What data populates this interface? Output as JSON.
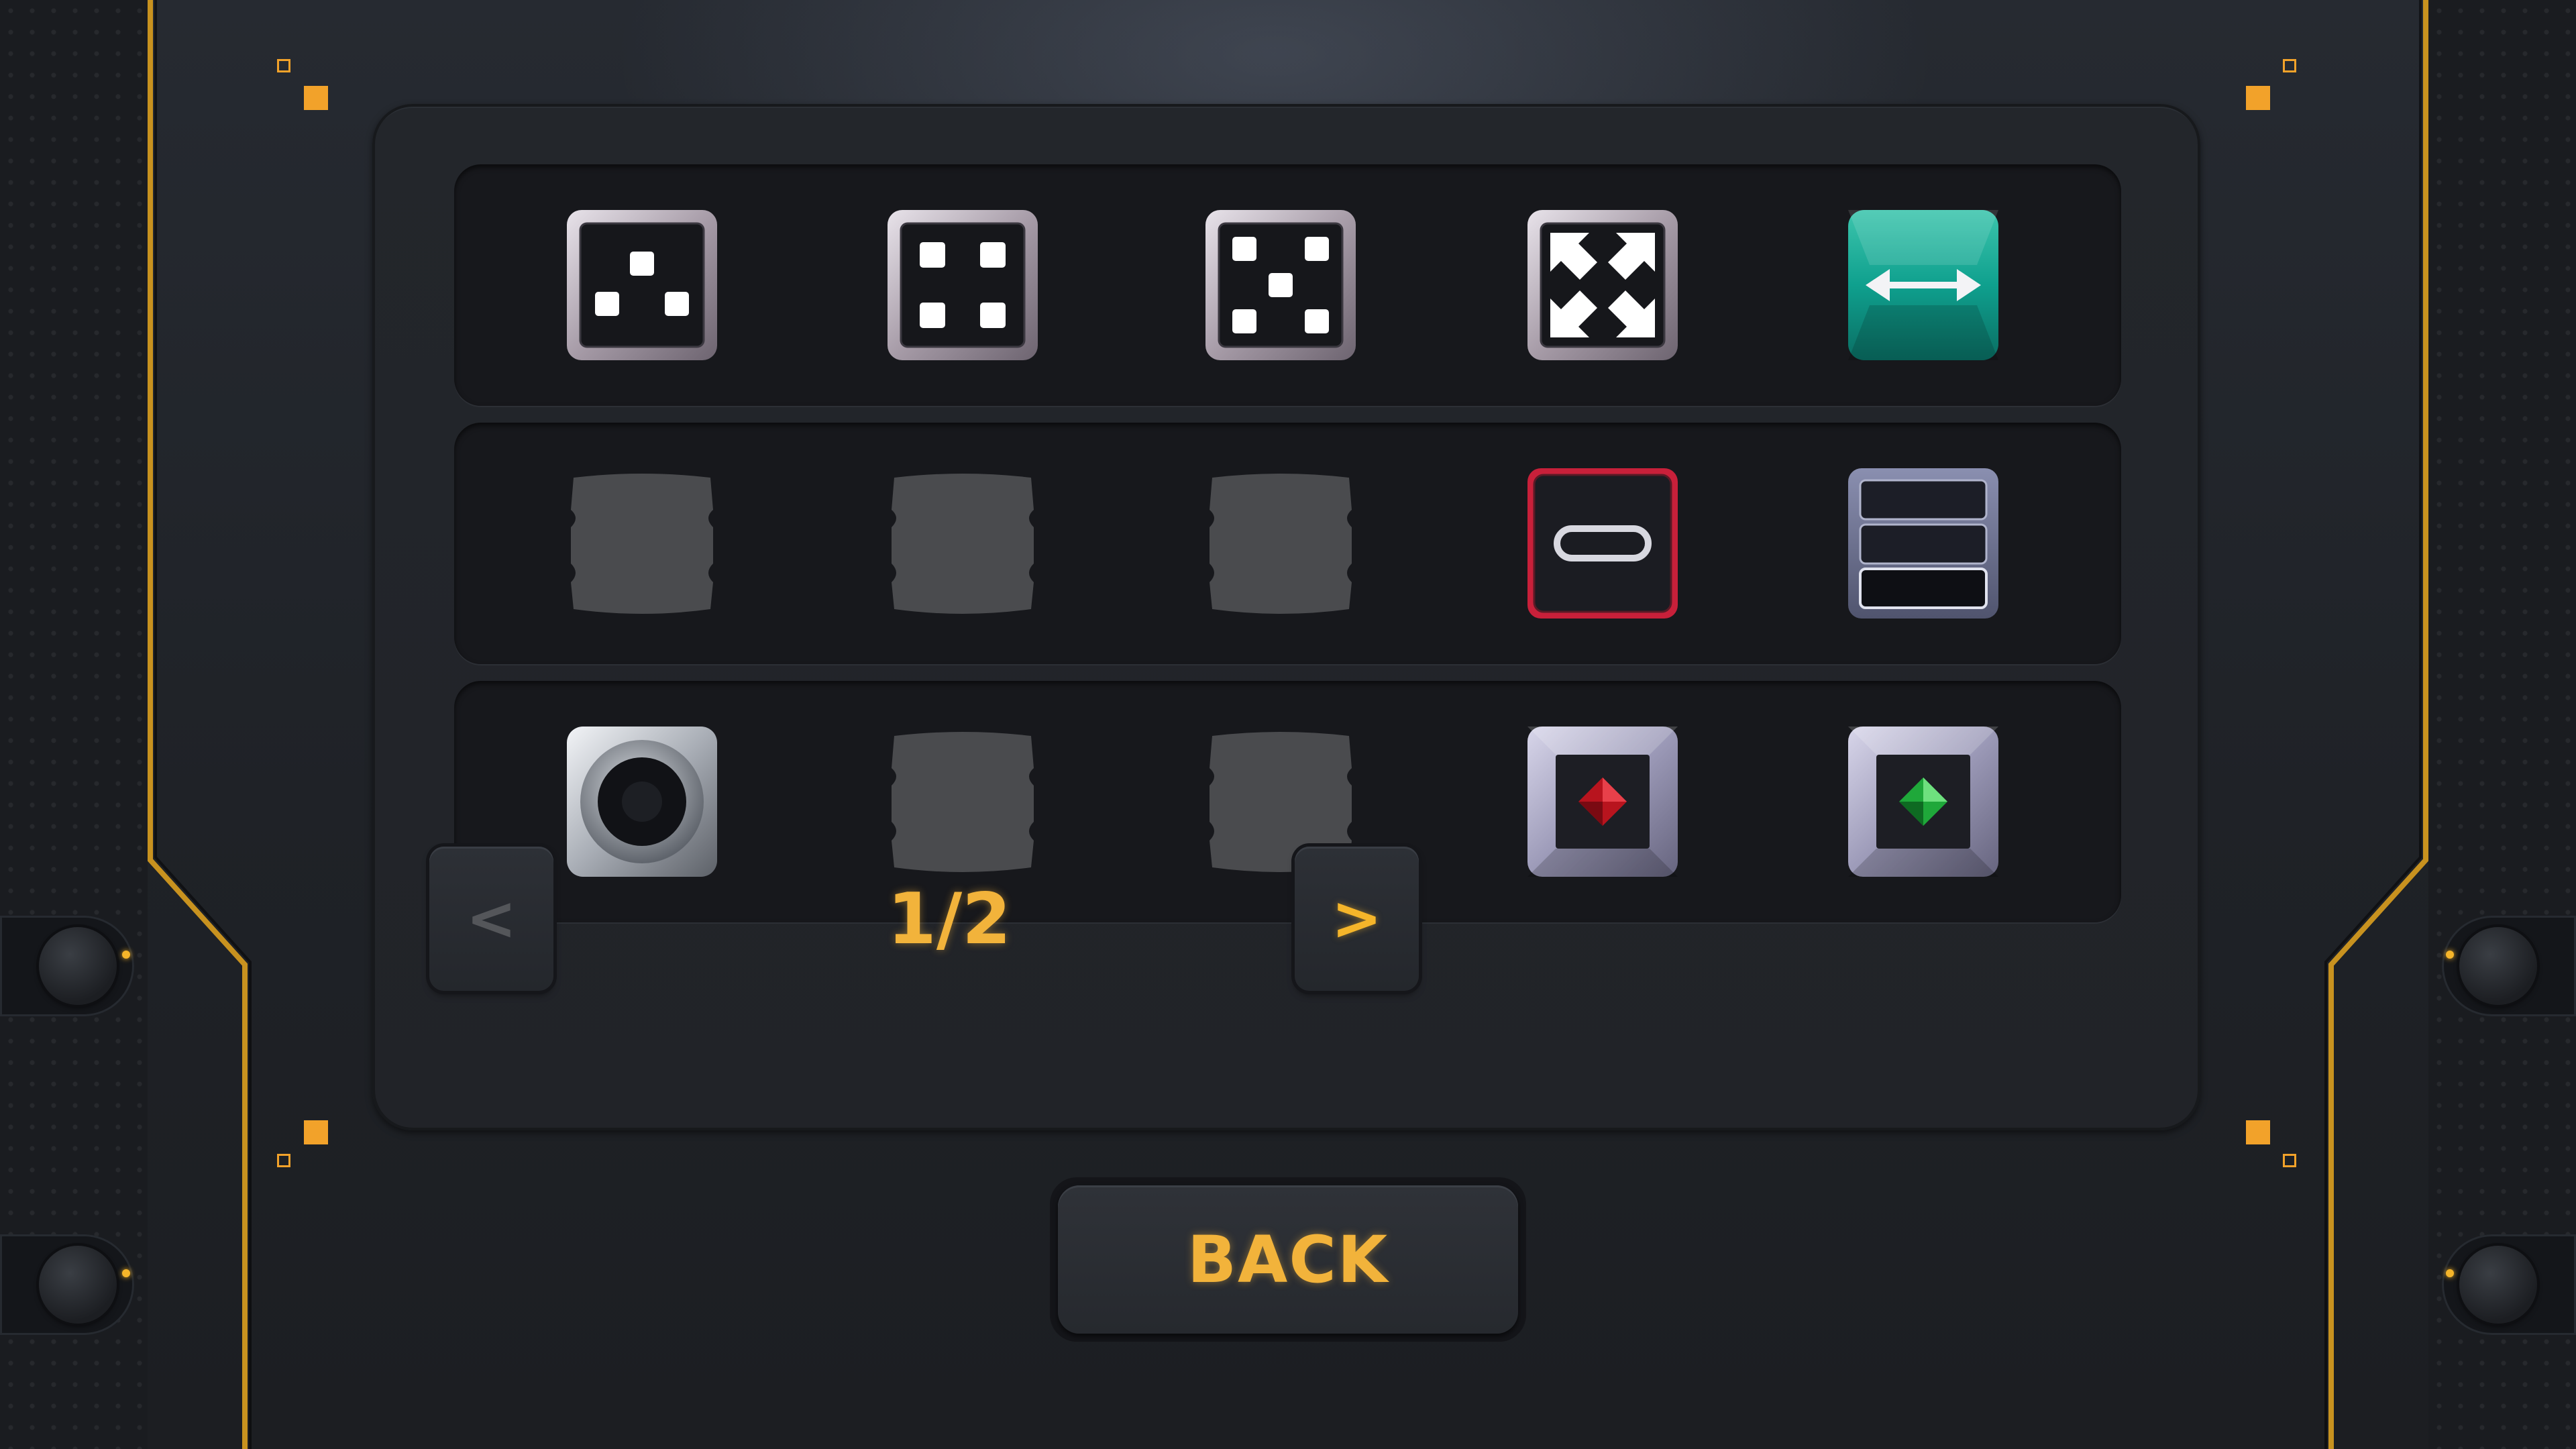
{
  "screen": {
    "accent_color": "#f5b52a",
    "background_color": "#1e2126"
  },
  "skin_grid": {
    "rows": [
      {
        "tiles": [
          {
            "icon": "dice-three-icon",
            "locked": false
          },
          {
            "icon": "dice-four-icon",
            "locked": false
          },
          {
            "icon": "dice-five-icon",
            "locked": false
          },
          {
            "icon": "expand-arrows-icon",
            "locked": false
          },
          {
            "icon": "horizontal-double-arrow-icon",
            "locked": false
          }
        ]
      },
      {
        "tiles": [
          {
            "icon": "locked-slot-icon",
            "locked": true
          },
          {
            "icon": "locked-slot-icon",
            "locked": true
          },
          {
            "icon": "locked-slot-icon",
            "locked": true
          },
          {
            "icon": "pill-slot-icon",
            "locked": false
          },
          {
            "icon": "stacked-bars-icon",
            "locked": false
          }
        ]
      },
      {
        "tiles": [
          {
            "icon": "metal-ring-icon",
            "locked": false
          },
          {
            "icon": "locked-slot-icon",
            "locked": true
          },
          {
            "icon": "locked-slot-icon",
            "locked": true
          },
          {
            "icon": "red-gem-icon",
            "locked": false
          },
          {
            "icon": "green-gem-icon",
            "locked": false
          }
        ]
      }
    ]
  },
  "pagination": {
    "prev_label": "<",
    "next_label": ">",
    "current_page": 1,
    "total_pages": 2,
    "indicator": "1/2"
  },
  "back_button": {
    "label": "BACK"
  }
}
